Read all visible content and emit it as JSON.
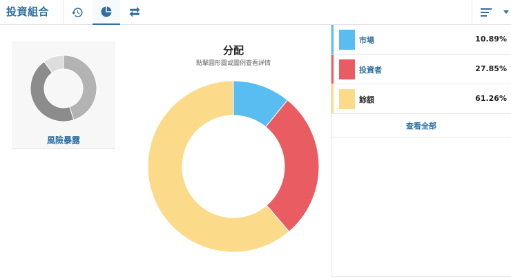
{
  "header": {
    "title": "投資組合",
    "tabs": [
      {
        "name": "history-icon",
        "active": false
      },
      {
        "name": "pie-chart-icon",
        "active": true
      },
      {
        "name": "transfer-icon",
        "active": false
      }
    ],
    "menu_icon": "list-menu-icon",
    "dropdown_icon": "caret-down-icon"
  },
  "risk_card": {
    "label": "風險暴露",
    "segments": [
      {
        "fraction": 0.45,
        "color": "#b3b3b3"
      },
      {
        "fraction": 0.45,
        "color": "#8c8c8c"
      },
      {
        "fraction": 0.1,
        "color": "#dddddd"
      }
    ]
  },
  "chart": {
    "title": "分配",
    "subtitle": "點擊圓形圖或圖例查看詳情"
  },
  "chart_data": {
    "type": "pie",
    "donut": true,
    "categories": [
      "市場",
      "投資者",
      "餘額"
    ],
    "values": [
      10.89,
      27.85,
      61.26
    ],
    "colors": [
      "#59bdf2",
      "#e95d62",
      "#fbdb8a"
    ],
    "title": "分配",
    "subtitle": "點擊圓形圖或圖例查看詳情",
    "legend": "right"
  },
  "legend": {
    "items": [
      {
        "name": "市場",
        "value": "10.89%",
        "color": "#59bdf2",
        "accent": "#59bdf2"
      },
      {
        "name": "投資者",
        "value": "27.85%",
        "color": "#e95d62",
        "accent": "#e95d62"
      },
      {
        "name": "餘額",
        "value": "61.26%",
        "color": "#fbdb8a",
        "accent": "#fbdb8a"
      }
    ],
    "view_all": "查看全部"
  }
}
